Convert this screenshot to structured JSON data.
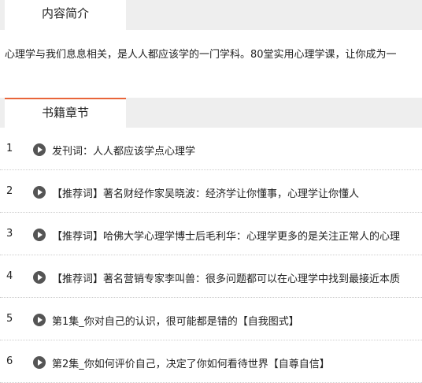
{
  "tabs": {
    "intro_label": "内容简介",
    "chapters_label": "书籍章节"
  },
  "intro": {
    "text": "心理学与我们息息相关，是人人都应该学的一门学科。80堂实用心理学课，让你成为一"
  },
  "chapters": [
    {
      "num": "1",
      "title": "发刊词：人人都应该学点心理学"
    },
    {
      "num": "2",
      "title": "【推荐词】著名财经作家吴晓波：经济学让你懂事，心理学让你懂人"
    },
    {
      "num": "3",
      "title": "【推荐词】哈佛大学心理学博士后毛利华：心理学更多的是关注正常人的心理"
    },
    {
      "num": "4",
      "title": "【推荐词】著名营销专家李叫兽：很多问题都可以在心理学中找到最接近本质"
    },
    {
      "num": "5",
      "title": "第1集_你对自己的认识，很可能都是错的【自我图式】"
    },
    {
      "num": "6",
      "title": "第2集_你如何评价自己，决定了你如何看待世界【自尊自信】"
    }
  ],
  "icons": {
    "play": "play-icon"
  }
}
